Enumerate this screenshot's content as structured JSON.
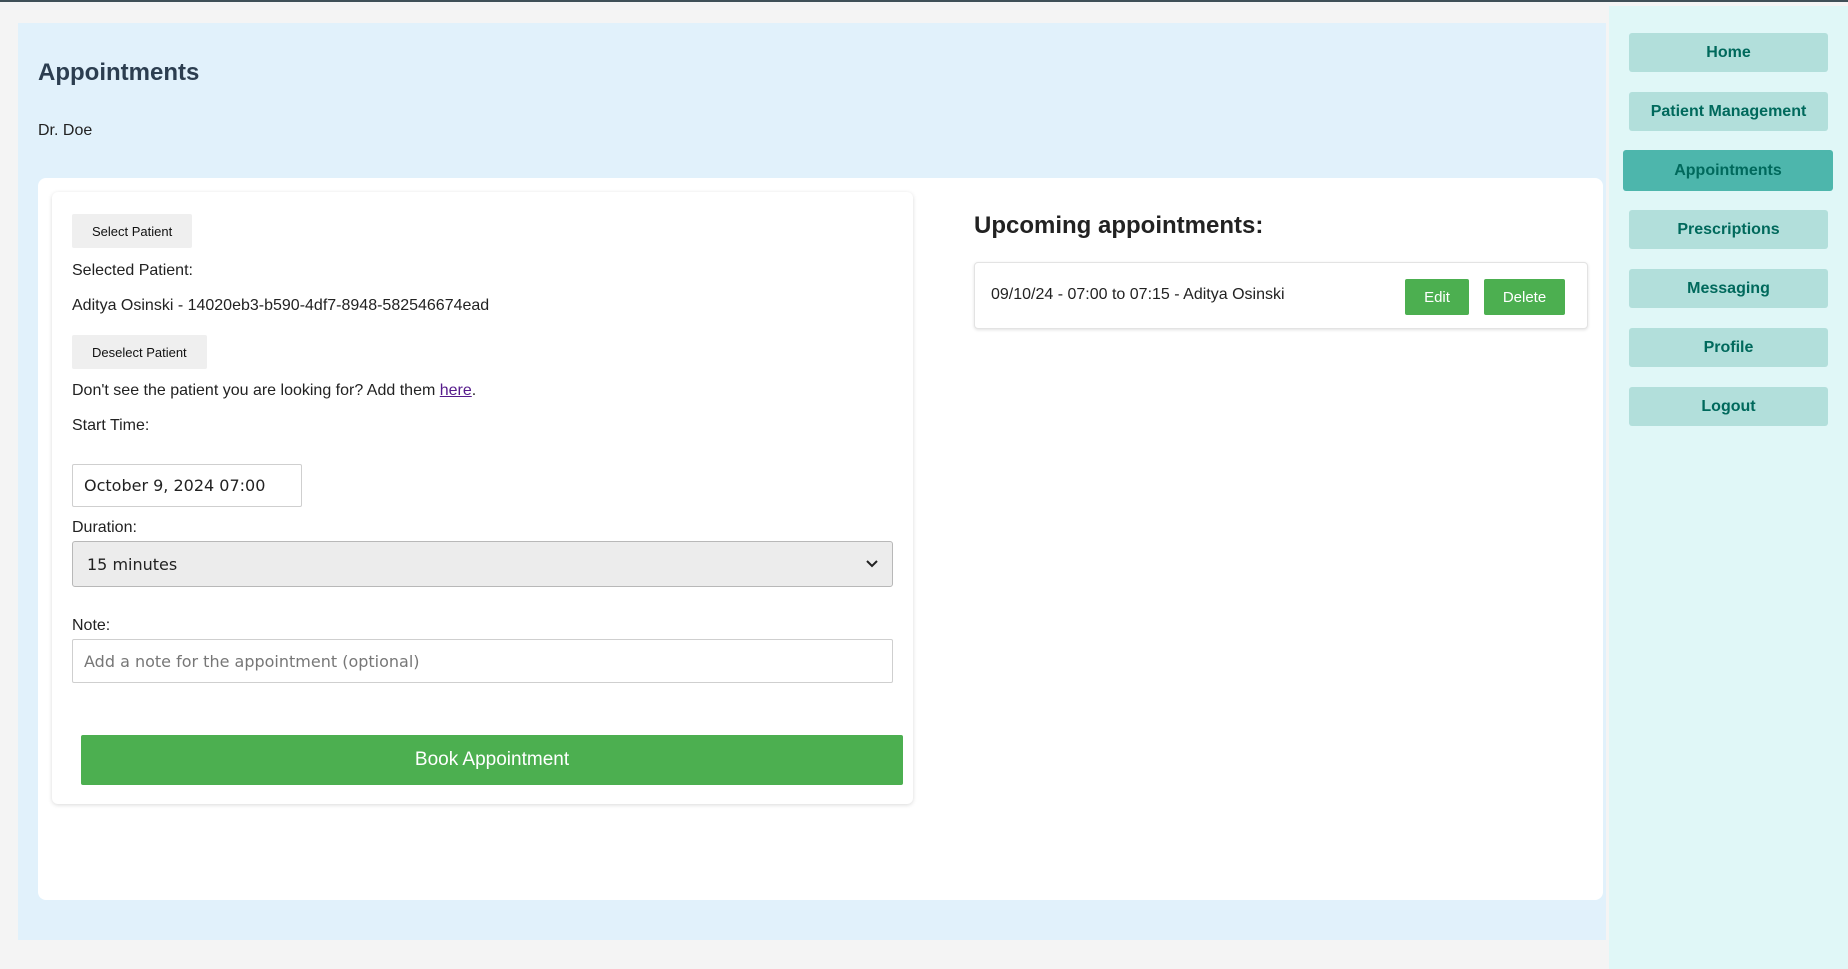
{
  "page": {
    "title": "Appointments",
    "doctor": "Dr. Doe"
  },
  "form": {
    "select_patient_label": "Select Patient",
    "selected_patient_label": "Selected Patient:",
    "selected_patient_value": "Aditya Osinski - 14020eb3-b590-4df7-8948-582546674ead",
    "deselect_patient_label": "Deselect Patient",
    "help_text_prefix": "Don't see the patient you are looking for? Add them ",
    "help_link": "here",
    "help_text_suffix": ".",
    "start_time_label": "Start Time:",
    "start_time_value": "October 9, 2024 07:00",
    "duration_label": "Duration:",
    "duration_value": "15 minutes",
    "note_label": "Note:",
    "note_placeholder": "Add a note for the appointment (optional)",
    "book_label": "Book Appointment"
  },
  "upcoming": {
    "title": "Upcoming appointments:",
    "items": [
      {
        "text": "09/10/24 - 07:00 to 07:15 - Aditya Osinski",
        "edit_label": "Edit",
        "delete_label": "Delete"
      }
    ]
  },
  "sidebar": {
    "items": [
      {
        "label": "Home",
        "active": false
      },
      {
        "label": "Patient Management",
        "active": false
      },
      {
        "label": "Appointments",
        "active": true
      },
      {
        "label": "Prescriptions",
        "active": false
      },
      {
        "label": "Messaging",
        "active": false
      },
      {
        "label": "Profile",
        "active": false
      },
      {
        "label": "Logout",
        "active": false
      }
    ]
  },
  "colors": {
    "primary_green": "#4caf50",
    "sidebar_bg": "#e0f7f7",
    "nav_button": "#b2dfdb",
    "nav_active": "#4db6ac",
    "nav_text": "#00695c",
    "main_bg": "#e1f1fb"
  }
}
